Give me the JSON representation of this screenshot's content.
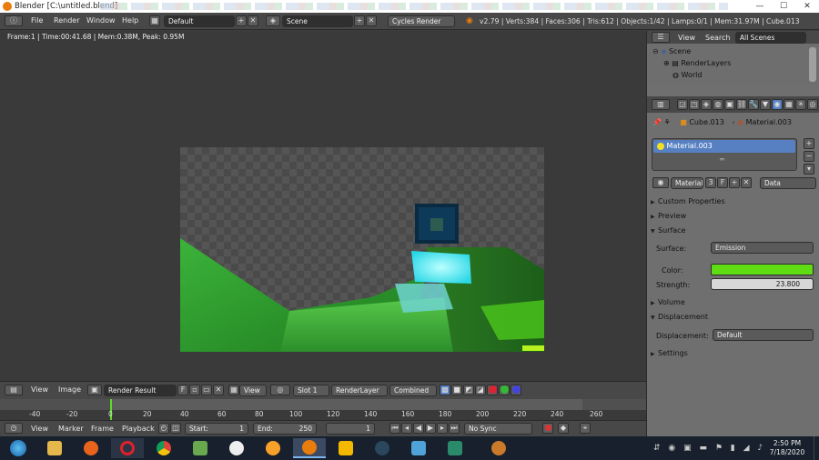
{
  "window": {
    "title": "Blender  [C:\\untitled.blend]"
  },
  "menu": {
    "items": [
      "File",
      "Render",
      "Window",
      "Help"
    ]
  },
  "topbar": {
    "layout": "Default",
    "scene": "Scene",
    "engine": "Cycles Render",
    "stats": "v2.79 | Verts:384 | Faces:306 | Tris:612 | Objects:1/42 | Lamps:0/1 | Mem:31.97M | Cube.013"
  },
  "viewport": {
    "frame_info": "Frame:1 | Time:00:41.68 | Mem:0.38M, Peak: 0.95M"
  },
  "image_editor": {
    "view": "View",
    "image": "Image",
    "image_name": "Render Result",
    "fake": "F",
    "view2": "View",
    "slot": "Slot 1",
    "layer": "RenderLayer",
    "pass": "Combined"
  },
  "timeline": {
    "ticks": [
      "-40",
      "-20",
      "0",
      "20",
      "40",
      "60",
      "80",
      "100",
      "120",
      "140",
      "160",
      "180",
      "200",
      "220",
      "240",
      "260"
    ],
    "current_frame": 1
  },
  "timeline_bar": {
    "view": "View",
    "marker": "Marker",
    "frame": "Frame",
    "playback": "Playback",
    "start_label": "Start:",
    "start": "1",
    "end_label": "End:",
    "end": "250",
    "current": "1",
    "sync": "No Sync"
  },
  "outliner": {
    "view": "View",
    "search": "Search",
    "filter": "All Scenes",
    "items": [
      "Scene",
      "RenderLayers",
      "World"
    ]
  },
  "properties": {
    "breadcrumb_object": "Cube.013",
    "breadcrumb_material": "Material.003",
    "slot_name": "Material.003",
    "material_name": "Material",
    "users": "3",
    "fake": "F",
    "link": "Data",
    "sections": {
      "custom": "Custom Properties",
      "preview": "Preview",
      "surface": "Surface",
      "volume": "Volume",
      "displacement": "Displacement",
      "settings": "Settings"
    },
    "surface_label": "Surface:",
    "surface_value": "Emission",
    "color_label": "Color:",
    "color_value": "#5fdc12",
    "strength_label": "Strength:",
    "strength_value": "23.800",
    "displacement_label": "Displacement:",
    "displacement_value": "Default"
  },
  "taskbar": {
    "time": "2:50 PM",
    "date": "7/18/2020"
  }
}
